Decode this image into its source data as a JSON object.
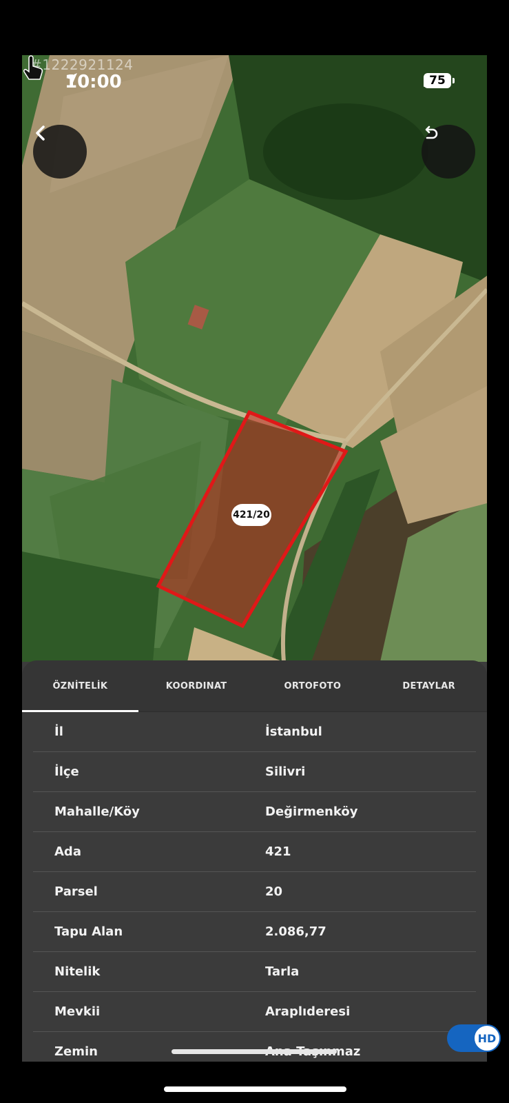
{
  "watermark_id": "#1222921124",
  "status_bar": {
    "time": "10:00",
    "battery": "75"
  },
  "map": {
    "parcel_label": "421/20"
  },
  "tabs": [
    {
      "label": "ÖZNİTELİK",
      "active": true
    },
    {
      "label": "KOORDINAT",
      "active": false
    },
    {
      "label": "ORTOFOTO",
      "active": false
    },
    {
      "label": "DETAYLAR",
      "active": false
    }
  ],
  "attributes": [
    {
      "key": "İl",
      "value": "İstanbul"
    },
    {
      "key": "İlçe",
      "value": "Silivri"
    },
    {
      "key": "Mahalle/Köy",
      "value": "Değirmenköy"
    },
    {
      "key": "Ada",
      "value": "421"
    },
    {
      "key": "Parsel",
      "value": "20"
    },
    {
      "key": "Tapu Alan",
      "value": "2.086,77"
    },
    {
      "key": "Nitelik",
      "value": "Tarla"
    },
    {
      "key": "Mevkii",
      "value": "Araplıderesi"
    },
    {
      "key": "Zemin",
      "value": "Ana Taşınmaz"
    }
  ],
  "hd_toggle": {
    "label": "HD",
    "on": true
  },
  "colors": {
    "parcel_outline": "#e01818",
    "tab_indicator": "#ffffff",
    "hd_blue": "#1565c0"
  },
  "icons": [
    "back-arrow-icon",
    "undo-icon",
    "location-arrow-icon",
    "signal-icon",
    "wifi-icon",
    "battery-icon",
    "hand-pointer-icon"
  ]
}
